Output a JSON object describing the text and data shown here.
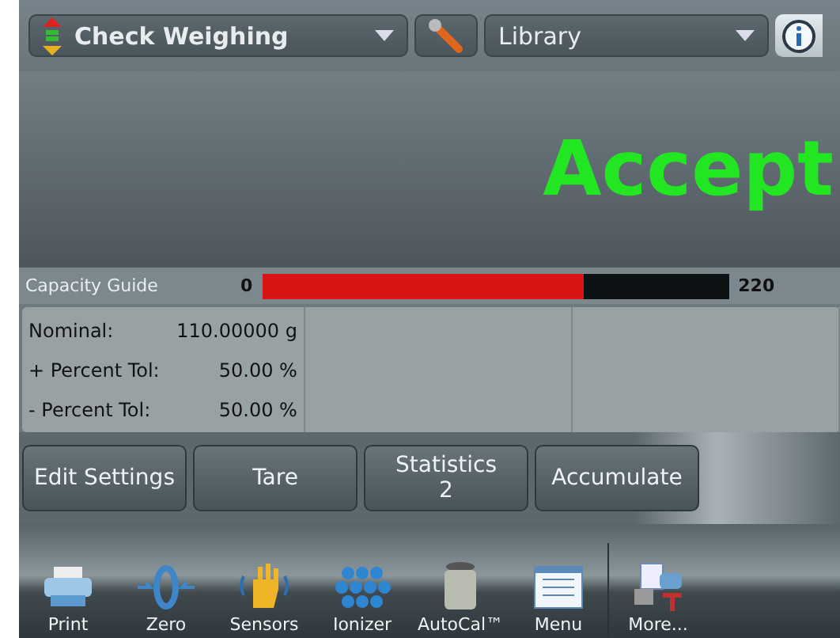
{
  "header": {
    "mode": "Check Weighing",
    "library": "Library"
  },
  "display": {
    "result": "Accept"
  },
  "capacity_guide": {
    "label": "Capacity Guide",
    "min": "0",
    "max": "220",
    "level": 0.69
  },
  "parameters": [
    {
      "label": "Nominal:",
      "value": "110.00000 g"
    },
    {
      "label": "+ Percent Tol:",
      "value": "50.00 %"
    },
    {
      "label": "- Percent Tol:",
      "value": "50.00 %"
    }
  ],
  "buttons": [
    {
      "label": "Edit Settings"
    },
    {
      "label": "Tare"
    },
    {
      "label": "Statistics",
      "count": "2"
    },
    {
      "label": "Accumulate"
    }
  ],
  "toolbar": [
    {
      "kind": "print",
      "label": "Print"
    },
    {
      "kind": "zero",
      "label": "Zero"
    },
    {
      "kind": "sensors",
      "label": "Sensors"
    },
    {
      "kind": "ionizer",
      "label": "Ionizer"
    },
    {
      "kind": "autocal",
      "label": "AutoCal™"
    },
    {
      "kind": "menu",
      "label": "Menu"
    },
    {
      "kind": "more",
      "label": "More..."
    }
  ]
}
